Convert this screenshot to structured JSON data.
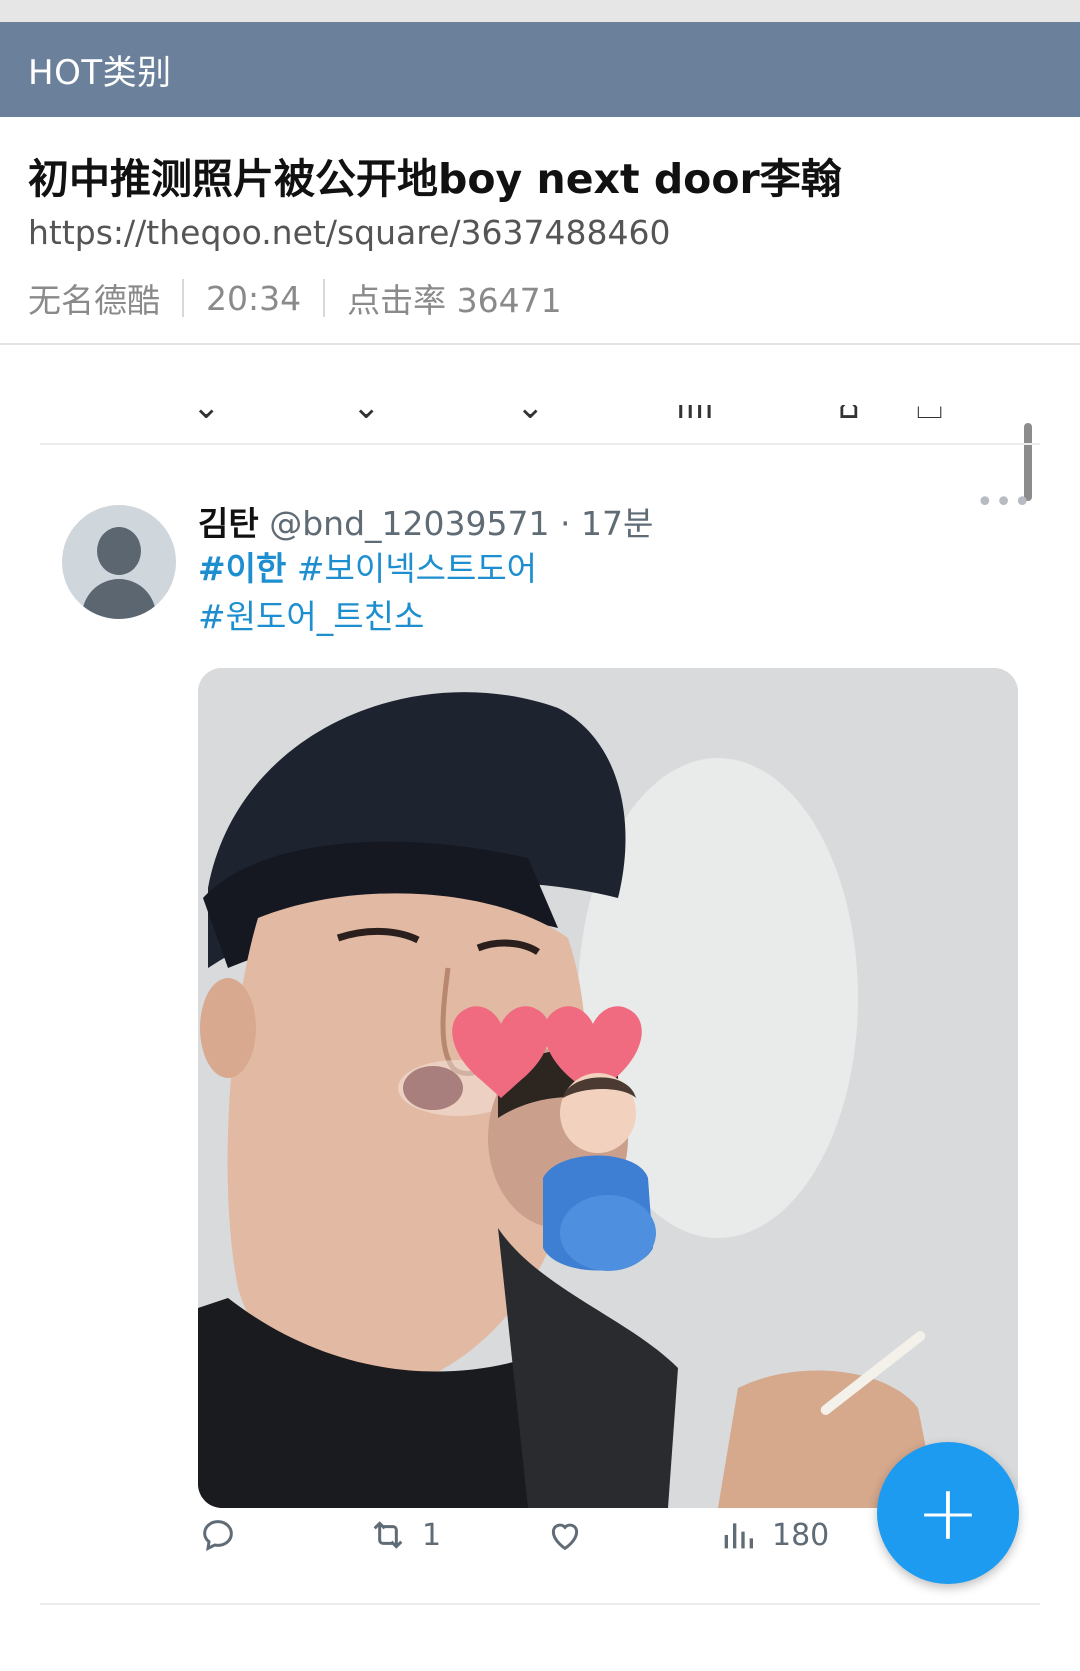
{
  "header": {
    "title": "HOT类别"
  },
  "article": {
    "title": "初中推测照片被公开地boy next door李翰",
    "url": "https://theqoo.net/square/3637488460",
    "author": "无名德酷",
    "time": "20:34",
    "views_label": "点击率 36471"
  },
  "tweet": {
    "display_name": "김탄",
    "handle_time": "@bnd_12039571 · 17분",
    "hashtags": {
      "tag1": "#이한",
      "tag2": "#보이넥스트도어",
      "tag3": "#원도어_트친소"
    },
    "more_icon": "more-horizontal-icon",
    "actions": {
      "reply_icon": "reply-icon",
      "retweet_icon": "retweet-icon",
      "retweet_count": "1",
      "like_icon": "heart-icon",
      "views_icon": "bar-chart-icon",
      "views_count": "180"
    },
    "fab_label": "+"
  },
  "colors": {
    "header_bg": "#6b819b",
    "link_blue": "#1d8fd0",
    "fab_blue": "#1d9bf0"
  }
}
